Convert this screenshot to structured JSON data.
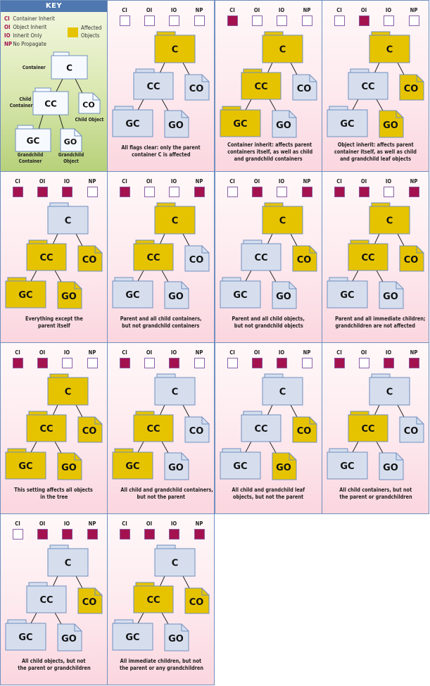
{
  "colors": {
    "affected": "#e6c300",
    "unaffected": "#d6deee",
    "key_node": "#f6faff",
    "node_border": "#6f8fbf",
    "flag_on": "#a3124e",
    "flag_off": "#ffffff",
    "flag_border": "#8b5fa8"
  },
  "key": {
    "title": "KEY",
    "legend": [
      {
        "abbr": "CI",
        "text": "Container Inherit"
      },
      {
        "abbr": "OI",
        "text": "Object Inherit"
      },
      {
        "abbr": "IO",
        "text": "Inherit Only"
      },
      {
        "abbr": "NP",
        "text": "No Propagate"
      }
    ],
    "affected_label": [
      "Affected",
      "Objects"
    ],
    "nodes": {
      "C": "C",
      "CC": "CC",
      "CO": "CO",
      "GC": "GC",
      "GO": "GO"
    },
    "captions": {
      "container": [
        "Container"
      ],
      "child_container": [
        "Child",
        "Container"
      ],
      "child_object": [
        "Child Object"
      ],
      "grandchild_container": [
        "Grandchild",
        "Container"
      ],
      "grandchild_object": [
        "Grandchild",
        "Object"
      ]
    }
  },
  "flag_labels": [
    "CI",
    "OI",
    "IO",
    "NP"
  ],
  "node_labels": {
    "C": "C",
    "CC": "CC",
    "CO": "CO",
    "GC": "GC",
    "GO": "GO"
  },
  "panels": [
    {
      "flags": {
        "CI": false,
        "OI": false,
        "IO": false,
        "NP": false
      },
      "affected": {
        "C": true,
        "CC": false,
        "CO": false,
        "GC": false,
        "GO": false
      },
      "caption": [
        "All flags clear: only the parent",
        "container C is affected"
      ]
    },
    {
      "flags": {
        "CI": true,
        "OI": false,
        "IO": false,
        "NP": false
      },
      "affected": {
        "C": true,
        "CC": true,
        "CO": false,
        "GC": true,
        "GO": false
      },
      "caption": [
        "Container inherit: affects parent",
        "containers itself, as well as child",
        "and grandchild containers"
      ]
    },
    {
      "flags": {
        "CI": false,
        "OI": true,
        "IO": false,
        "NP": false
      },
      "affected": {
        "C": true,
        "CC": false,
        "CO": true,
        "GC": false,
        "GO": true
      },
      "caption": [
        "Object inherit: affects parent",
        "container itself, as well as child",
        "and grandchild leaf objects"
      ]
    },
    {
      "flags": {
        "CI": true,
        "OI": true,
        "IO": true,
        "NP": false
      },
      "affected": {
        "C": false,
        "CC": true,
        "CO": true,
        "GC": true,
        "GO": true
      },
      "caption": [
        "Everything except the",
        "parent itself"
      ]
    },
    {
      "flags": {
        "CI": true,
        "OI": false,
        "IO": false,
        "NP": true
      },
      "affected": {
        "C": true,
        "CC": true,
        "CO": false,
        "GC": false,
        "GO": false
      },
      "caption": [
        "Parent and all child containers,",
        "but not grandchild containers"
      ]
    },
    {
      "flags": {
        "CI": false,
        "OI": true,
        "IO": false,
        "NP": true
      },
      "affected": {
        "C": true,
        "CC": false,
        "CO": true,
        "GC": false,
        "GO": false
      },
      "caption": [
        "Parent and all child objects,",
        "but not grandchild objects"
      ]
    },
    {
      "flags": {
        "CI": true,
        "OI": true,
        "IO": false,
        "NP": true
      },
      "affected": {
        "C": true,
        "CC": true,
        "CO": true,
        "GC": false,
        "GO": false
      },
      "caption": [
        "Parent and all immediate children;",
        "grandchildren are not affected"
      ]
    },
    {
      "flags": {
        "CI": true,
        "OI": true,
        "IO": false,
        "NP": false
      },
      "affected": {
        "C": true,
        "CC": true,
        "CO": true,
        "GC": true,
        "GO": true
      },
      "caption": [
        "This setting affects all objects",
        "in the tree"
      ]
    },
    {
      "flags": {
        "CI": true,
        "OI": false,
        "IO": true,
        "NP": false
      },
      "affected": {
        "C": false,
        "CC": true,
        "CO": false,
        "GC": true,
        "GO": false
      },
      "caption": [
        "All child and grandchild containers,",
        "but not the parent"
      ]
    },
    {
      "flags": {
        "CI": false,
        "OI": true,
        "IO": true,
        "NP": false
      },
      "affected": {
        "C": false,
        "CC": false,
        "CO": true,
        "GC": false,
        "GO": true
      },
      "caption": [
        "All child and grandchild leaf",
        "objects, but not the parent"
      ]
    },
    {
      "flags": {
        "CI": true,
        "OI": false,
        "IO": true,
        "NP": true
      },
      "affected": {
        "C": false,
        "CC": true,
        "CO": false,
        "GC": false,
        "GO": false
      },
      "caption": [
        "All child containers, but not",
        "the parent or grandchildren"
      ]
    },
    {
      "flags": {
        "CI": false,
        "OI": true,
        "IO": true,
        "NP": true
      },
      "affected": {
        "C": false,
        "CC": false,
        "CO": true,
        "GC": false,
        "GO": false
      },
      "caption": [
        "All child objects, but not",
        "the parent or grandchildren"
      ]
    },
    {
      "flags": {
        "CI": true,
        "OI": true,
        "IO": true,
        "NP": true
      },
      "affected": {
        "C": false,
        "CC": true,
        "CO": true,
        "GC": false,
        "GO": false
      },
      "caption": [
        "All immediate children, but not",
        "the parent or any grandchildren"
      ]
    }
  ]
}
